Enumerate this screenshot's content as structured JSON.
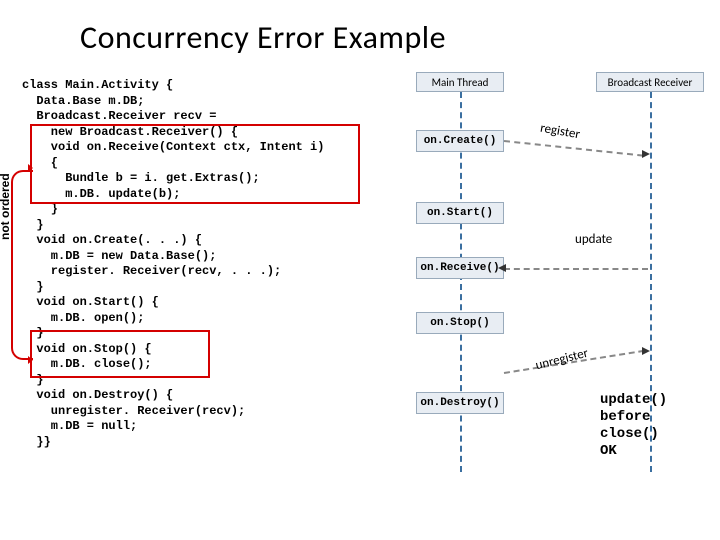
{
  "title": "Concurrency Error Example",
  "not_ordered": "not ordered",
  "code": "class Main.Activity {\n  Data.Base m.DB;\n  Broadcast.Receiver recv =\n    new Broadcast.Receiver() {\n    void on.Receive(Context ctx, Intent i)\n    {\n      Bundle b = i. get.Extras();\n      m.DB. update(b);\n    }\n  }\n  void on.Create(. . .) {\n    m.DB = new Data.Base();\n    register. Receiver(recv, . . .);\n  }\n  void on.Start() {\n    m.DB. open();\n  }\n  void on.Stop() {\n    m.DB. close();\n  }\n  void on.Destroy() {\n    unregister. Receiver(recv);\n    m.DB = null;\n  }}",
  "diagram": {
    "headers": {
      "main": "Main Thread",
      "bcast": "Broadcast Receiver"
    },
    "calls": {
      "create": "on.Create()",
      "start": "on.Start()",
      "receive": "on.Receive()",
      "stop": "on.Stop()",
      "destroy": "on.Destroy()"
    },
    "messages": {
      "register": "register",
      "update": "update",
      "unregister": "unregister"
    }
  },
  "conclusion": {
    "l1": "update()",
    "l2": "before",
    "l3": "close()",
    "l4": "OK"
  }
}
